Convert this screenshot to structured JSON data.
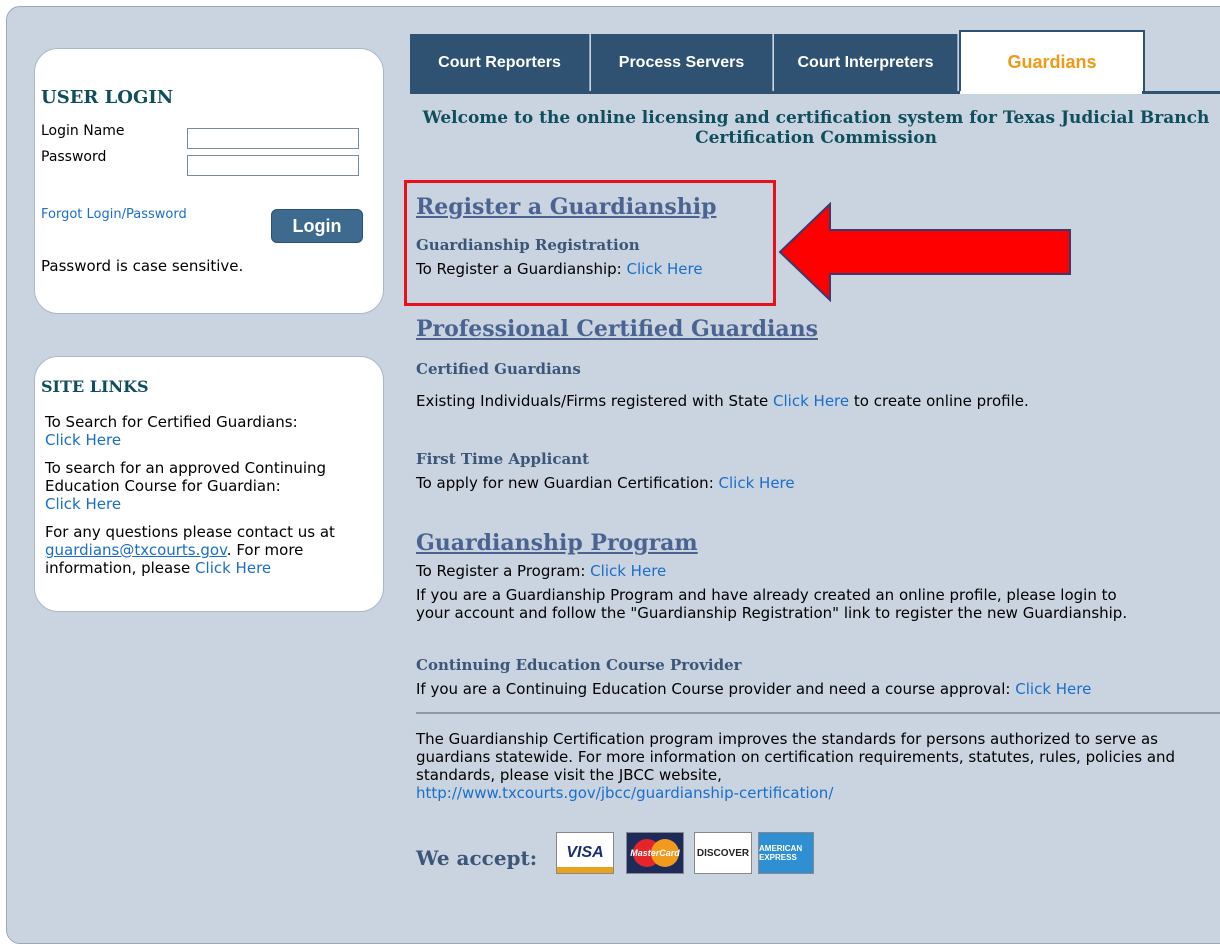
{
  "login": {
    "title": "USER LOGIN",
    "login_name_label": "Login Name",
    "password_label": "Password",
    "login_name_value": "",
    "password_value": "",
    "forgot": "Forgot Login/Password",
    "button": "Login",
    "note": "Password is case sensitive."
  },
  "site_links": {
    "title": "SITE LINKS",
    "search_text": "To Search for Certified Guardians:",
    "search_link": "Click Here",
    "course_text": "To search for an approved Continuing Education Course for Guardian:",
    "course_link": "Click Here",
    "contact_text": "For any questions please contact us at",
    "contact_email": "guardians@txcourts.gov",
    "contact_more": ". For more information, please",
    "contact_link": "Click Here"
  },
  "tabs": [
    {
      "label": "Court Reporters"
    },
    {
      "label": "Process Servers"
    },
    {
      "label": "Court Interpreters"
    },
    {
      "label": "Guardians"
    }
  ],
  "welcome": "Welcome to the online licensing and certification system for Texas Judicial Branch Certification Commission",
  "register": {
    "heading": "Register a Guardianship",
    "sub": "Guardianship Registration",
    "text": "To Register a Guardianship:",
    "link": "Click Here"
  },
  "professional": {
    "heading": "Professional Certified Guardians",
    "sub": "Certified Guardians",
    "text_before": "Existing Individuals/Firms registered with State",
    "link": "Click Here",
    "text_after": "to create online profile."
  },
  "first_time": {
    "sub": "First Time Applicant",
    "text": "To apply for new Guardian Certification:",
    "link": "Click Here"
  },
  "program": {
    "heading": "Guardianship Program",
    "text": "To Register a Program:",
    "link": "Click Here",
    "line1": "If you are a Guardianship Program and have already created an online profile, please login to",
    "line2": "your account and follow the \"Guardianship Registration\" link to register the new Guardianship."
  },
  "ce_provider": {
    "sub": "Continuing Education Course Provider",
    "text": "If you are a Continuing Education Course provider and need a course approval:",
    "link": "Click Here"
  },
  "footer": {
    "text": "The Guardianship Certification program improves the standards for persons authorized to serve as guardians statewide. For more information on certification requirements, statutes, rules, policies and standards, please visit the JBCC website,",
    "url": "http://www.txcourts.gov/jbcc/guardianship-certification/"
  },
  "accept": {
    "label": "We accept:",
    "cards": [
      "VISA",
      "MasterCard",
      "DISCOVER",
      "AMERICAN EXPRESS"
    ]
  },
  "colors": {
    "tab_bg": "#2f5172",
    "active_tab_text": "#ee9a16",
    "heading": "#4a6390",
    "link": "#1a6ec8",
    "highlight": "#e8101a",
    "arrow": "#ff0000"
  }
}
